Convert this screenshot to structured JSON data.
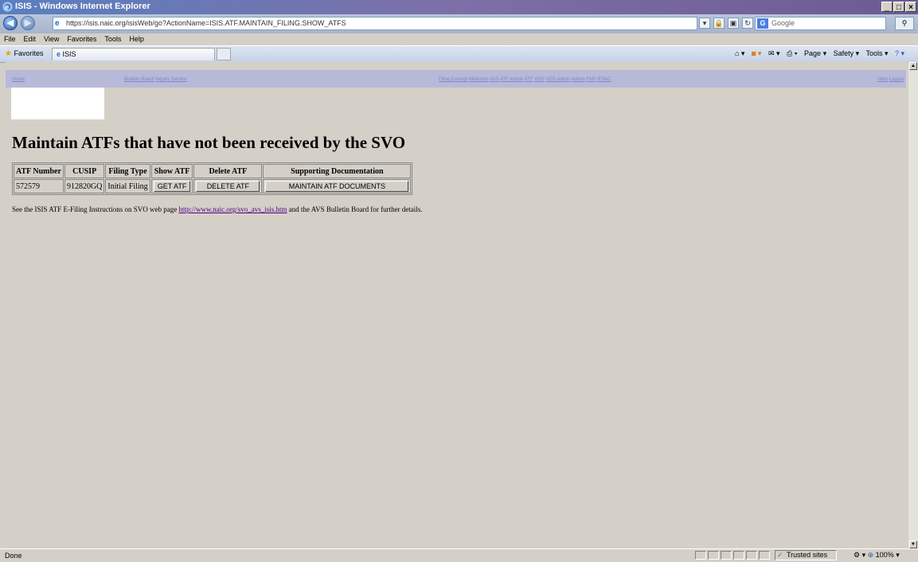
{
  "window": {
    "title": "ISIS - Windows Internet Explorer"
  },
  "browser": {
    "url": "https://isis.naic.org/isisWeb/go?ActionName=ISIS.ATF.MAINTAIN_FILING.SHOW_ATFS",
    "search_placeholder": "Google",
    "menu": [
      "File",
      "Edit",
      "View",
      "Favorites",
      "Tools",
      "Help"
    ],
    "favorites_label": "Favorites",
    "tab_label": "ISIS",
    "commands": [
      "Page ▾",
      "Safety ▾",
      "Tools ▾"
    ]
  },
  "nav": {
    "left": [
      "Home"
    ],
    "mid1": [
      "Bulletin Board",
      "Inquiry Service"
    ],
    "mid2": [
      "Filing Exempt",
      "Mailroom",
      "AVS",
      "ATF Admin",
      "ATF",
      "VOS",
      "VOS Admin",
      "Admin",
      "FAR",
      "IFSAC"
    ],
    "right": [
      "Help",
      "Logout"
    ]
  },
  "page": {
    "title": "Maintain ATFs that have not been received by the SVO",
    "table": {
      "headers": [
        "ATF Number",
        "CUSIP",
        "Filing Type",
        "Show ATF",
        "Delete ATF",
        "Supporting Documentation"
      ],
      "rows": [
        {
          "atf_number": "572579",
          "cusip": "912820GQ",
          "filing_type": "Initial Filing",
          "show": "GET ATF",
          "delete": "DELETE ATF",
          "docs": "MAINTAIN ATF DOCUMENTS"
        }
      ]
    },
    "footer": {
      "prefix": "See the ISIS ATF E-Filing Instructions on SVO web page",
      "link": "http://www.naic.org/svo_avs_isis.htm",
      "suffix": "and the AVS Bulletin Board for further details."
    }
  },
  "status": {
    "text": "Done",
    "zone": "Trusted sites",
    "zoom": "100%"
  }
}
